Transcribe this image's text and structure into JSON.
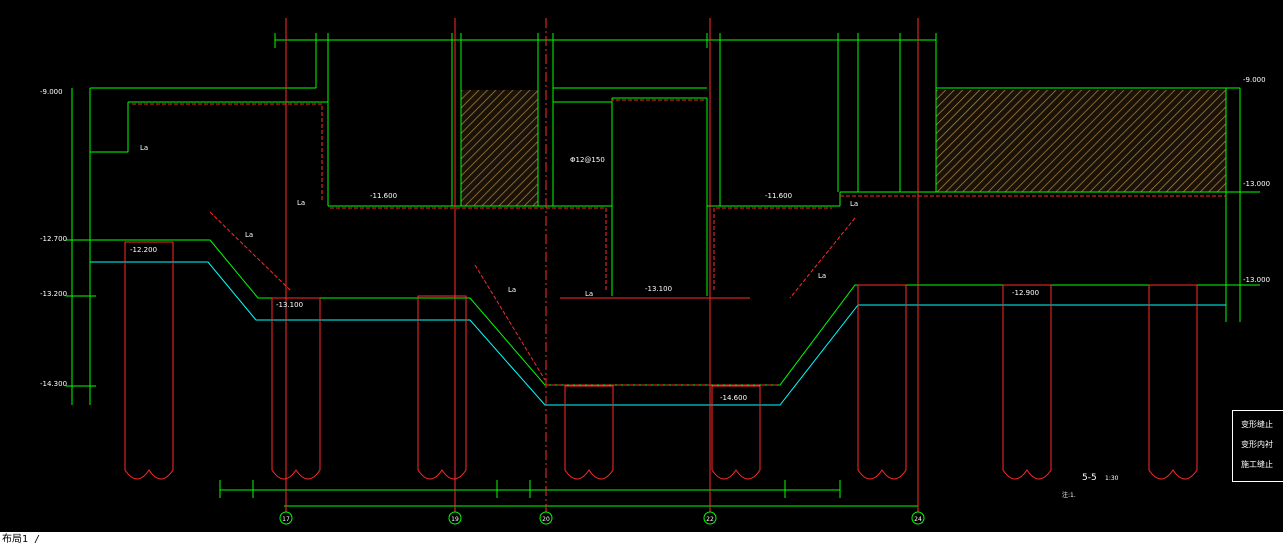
{
  "levels": {
    "top_left": "-9.000",
    "top_right": "-9.000",
    "l1": "-12.700",
    "l2": "-13.200",
    "l3": "-14.300",
    "r_mid": "-13.000",
    "r_low": "-13.000",
    "slab_left": "-11.600",
    "slab_right": "-11.600",
    "pile_left_top": "-12.200",
    "base_left": "-13.100",
    "pit_mid": "-13.100",
    "pit_bottom": "-14.600",
    "base_right": "-12.900"
  },
  "labels": {
    "la": "La",
    "rebar": "Φ12@150",
    "section": "5-5",
    "scale": "1:30",
    "notes_title": "注:1.",
    "legend_1": "变形缝止",
    "legend_2": "变形内衬",
    "legend_3": "施工缝止"
  },
  "axes": [
    "17",
    "19",
    "20",
    "22",
    "24"
  ],
  "cmd_text": "布局1 /",
  "colors": {
    "green": "#00ff00",
    "red": "#ff2a2a",
    "cyan": "#00ffff",
    "white": "#ffffff",
    "hatch": "#b08a40"
  }
}
